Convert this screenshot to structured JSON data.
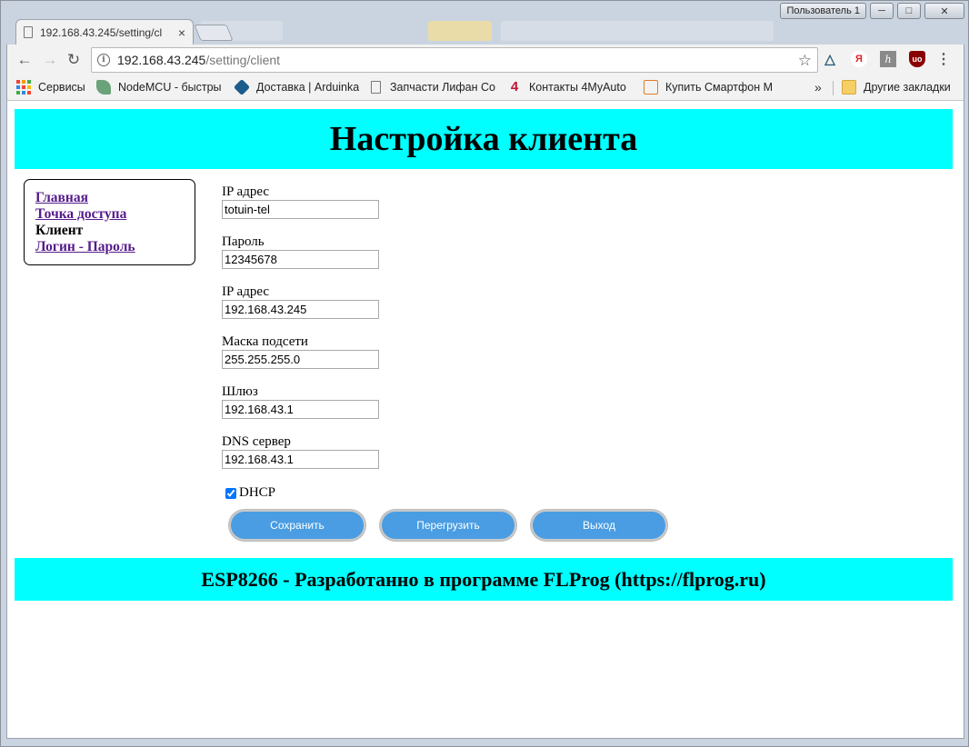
{
  "window": {
    "user_badge": "Пользователь 1",
    "minimize_icon": "minimize-icon",
    "maximize_icon": "maximize-icon",
    "close_icon": "close-icon"
  },
  "tab": {
    "title": "192.168.43.245/setting/cl",
    "close_glyph": "×"
  },
  "toolbar": {
    "url_host": "192.168.43.245",
    "url_path": "/setting/client"
  },
  "bookmarks": {
    "apps_label": "Сервисы",
    "items": [
      {
        "label": "NodeMCU - быстры",
        "icon": "leaf-icon"
      },
      {
        "label": "Доставка | Arduinka",
        "icon": "arduinka-icon"
      },
      {
        "label": "Запчасти Лифан Со",
        "icon": "page-icon"
      },
      {
        "label": "Контакты 4MyAuto",
        "icon": "four-icon"
      },
      {
        "label": "Купить Смартфон М",
        "icon": "cart-icon"
      }
    ],
    "more": "»",
    "other_label": "Другие закладки"
  },
  "page": {
    "header_title": "Настройка клиента",
    "nav": {
      "items": [
        {
          "label": "Главная",
          "current": false
        },
        {
          "label": "Точка доступа",
          "current": false
        },
        {
          "label": "Клиент",
          "current": true
        },
        {
          "label": "Логин - Пароль",
          "current": false
        }
      ]
    },
    "form": {
      "fields": [
        {
          "label": "IP адрес",
          "value": "totuin-tel"
        },
        {
          "label": "Пароль",
          "value": "12345678"
        },
        {
          "label": "IP адрес",
          "value": "192.168.43.245"
        },
        {
          "label": "Маска подсети",
          "value": "255.255.255.0"
        },
        {
          "label": "Шлюз",
          "value": "192.168.43.1"
        },
        {
          "label": "DNS сервер",
          "value": "192.168.43.1"
        }
      ],
      "dhcp_label": "DHCP",
      "dhcp_checked": true
    },
    "buttons": {
      "save": "Сохранить",
      "reboot": "Перегрузить",
      "exit": "Выход"
    },
    "button_color": "#4a9de2",
    "banner_color": "#00ffff",
    "footer_text": "ESP8266 - Разработанно в программе FLProg (https://flprog.ru)"
  }
}
